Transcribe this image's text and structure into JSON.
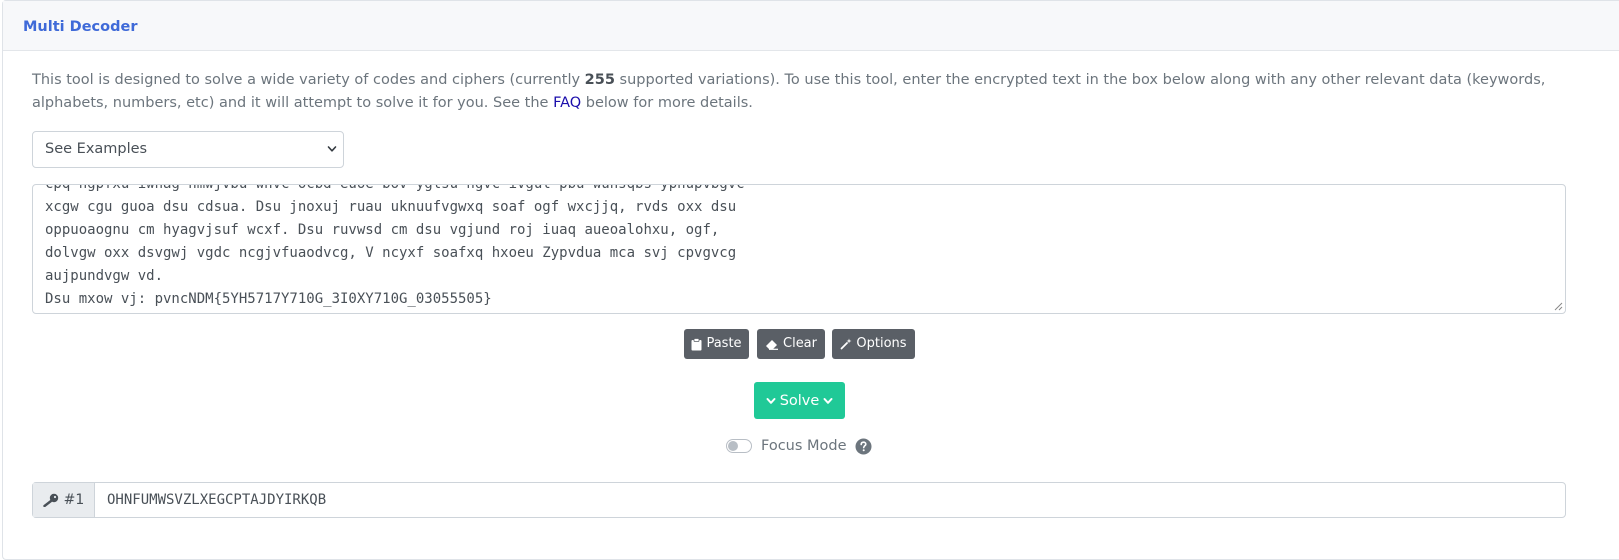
{
  "header": {
    "title": "Multi Decoder"
  },
  "intro": {
    "text_before": "This tool is designed to solve a wide variety of codes and ciphers (currently ",
    "count": "255",
    "text_middle": " supported variations). To use this tool, enter the encrypted text in the box below along with any other relevant data (keywords, alphabets, numbers, etc) and it will attempt to solve it for you. See the ",
    "faq_link": "FAQ",
    "text_after": " below for more details."
  },
  "examples_select": {
    "selected": "See Examples"
  },
  "ciphertext": {
    "lines": [
      "cpq ngpfxu iwnag nmwjvbu whvc ocbd euoe bov yglsu ngvc ivgul pbu wuhsqbs yphupvbgvc",
      "xcgw cgu guoa dsu cdsua. Dsu jnoxuj ruau uknuufvgwxq soaf ogf wxcjjq, rvds oxx dsu",
      "oppuoaognu cm hyagvjsuf wcxf. Dsu ruvwsd cm dsu vgjund roj iuaq aueoalohxu, ogf,",
      "dolvgw oxx dsvgwj vgdc ncgjvfuaodvcg, V ncyxf soafxq hxoeu Zypvdua mca svj cpvgvcg",
      "aujpundvgw vd.",
      "Dsu mxow vj: pvncNDM{5YH5717Y710G_3I0XY710G_03055505}"
    ]
  },
  "buttons": {
    "paste": "Paste",
    "clear": "Clear",
    "options": "Options",
    "solve": "Solve"
  },
  "focus_mode": {
    "label": "Focus Mode",
    "enabled": false
  },
  "key_input": {
    "label": "#1",
    "value": "OHNFUMWSVZLXEGCPTAJDYIRKQB"
  },
  "colors": {
    "accent": "#3f6ad8",
    "solve": "#20c997",
    "button_dark": "#5a5f66",
    "link": "#1a0dab"
  },
  "icons": {
    "select": "chevron-down-icon",
    "paste": "clipboard-icon",
    "clear": "eraser-icon",
    "options": "magic-wand-icon",
    "solve": "chevron-down-icon",
    "help": "question-circle-icon",
    "key": "key-icon"
  }
}
